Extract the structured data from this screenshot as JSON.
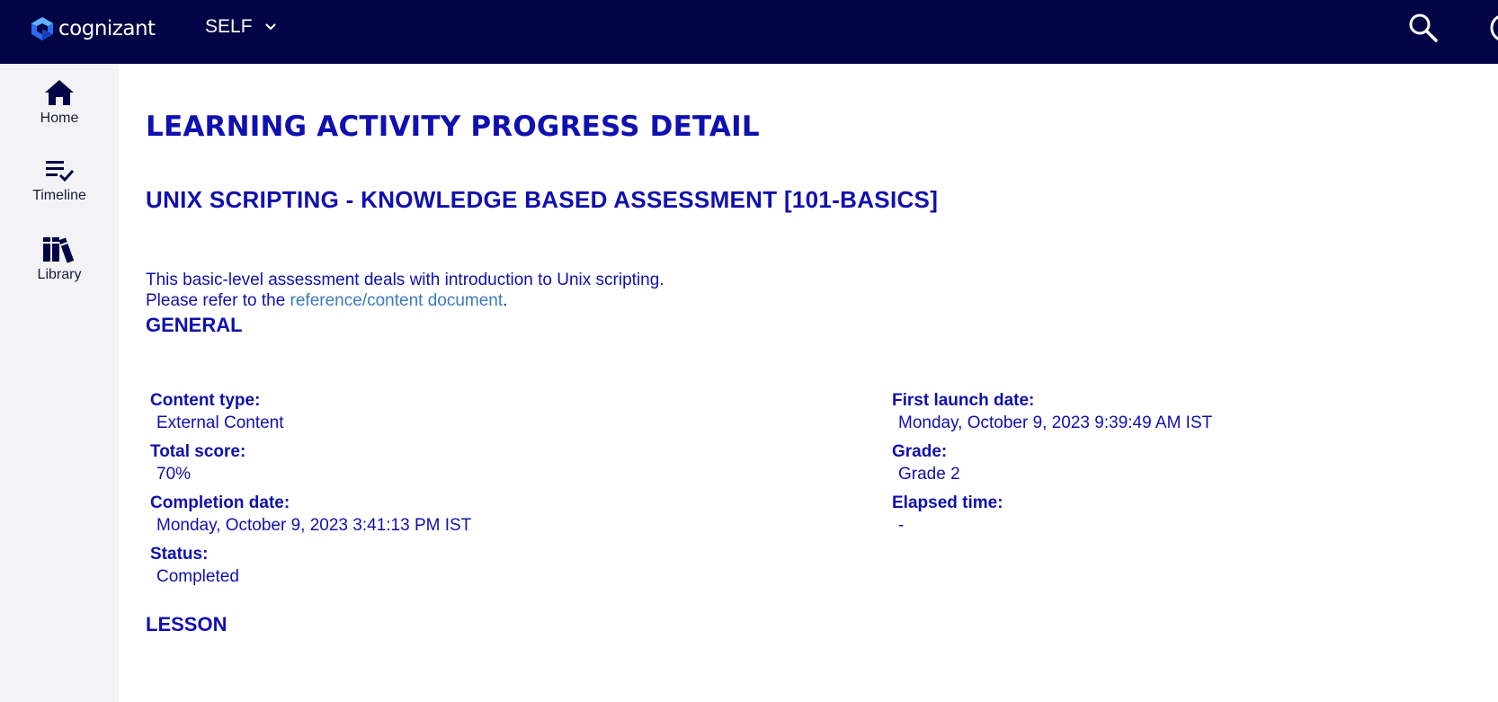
{
  "header": {
    "logo_text": "cognizant",
    "context_label": "SELF",
    "brand_color": "#020445"
  },
  "sidebar": {
    "items": [
      {
        "label": "Home",
        "icon": "home-icon"
      },
      {
        "label": "Timeline",
        "icon": "timeline-icon"
      },
      {
        "label": "Library",
        "icon": "library-icon"
      }
    ]
  },
  "main": {
    "page_title": "LEARNING ACTIVITY PROGRESS DETAIL",
    "course_title": "UNIX SCRIPTING - KNOWLEDGE BASED ASSESSMENT [101-BASICS]",
    "description_line1": "This basic-level assessment deals with introduction to Unix scripting.",
    "description_line2_prefix": "Please refer to the ",
    "description_link": "reference/content document",
    "description_line2_suffix": ".",
    "general_title": "GENERAL",
    "lesson_title": "LESSON",
    "text_color": "#1010b0",
    "link_color": "#3a7bbf"
  },
  "general": {
    "content_type": {
      "label": "Content type:",
      "value": "External Content"
    },
    "total_score": {
      "label": "Total score:",
      "value": "70%"
    },
    "completion_date": {
      "label": "Completion date:",
      "value": "Monday, October 9, 2023 3:41:13 PM IST"
    },
    "status": {
      "label": "Status:",
      "value": "Completed"
    },
    "first_launch_date": {
      "label": "First launch date:",
      "value": "Monday, October 9, 2023 9:39:49 AM IST"
    },
    "grade": {
      "label": "Grade:",
      "value": "Grade 2"
    },
    "elapsed_time": {
      "label": "Elapsed time:",
      "value": "-"
    }
  }
}
